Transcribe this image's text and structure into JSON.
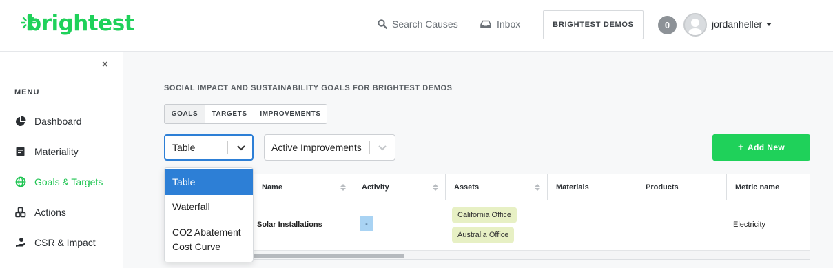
{
  "header": {
    "logo": "brightest",
    "search_label": "Search Causes",
    "inbox_label": "Inbox",
    "demos_label": "BRIGHTEST DEMOS",
    "notification_count": "0",
    "username": "jordanheller"
  },
  "sidebar": {
    "close_symbol": "×",
    "menu_heading": "MENU",
    "items": [
      {
        "label": "Dashboard",
        "icon": "pie-chart-icon"
      },
      {
        "label": "Materiality",
        "icon": "square-list-icon"
      },
      {
        "label": "Goals & Targets",
        "icon": "globe-icon",
        "active": true
      },
      {
        "label": "Actions",
        "icon": "cubes-icon"
      },
      {
        "label": "CSR & Impact",
        "icon": "hand-holding-icon"
      }
    ]
  },
  "main": {
    "title": "SOCIAL IMPACT AND SUSTAINABILITY GOALS FOR BRIGHTEST DEMOS",
    "tabs": [
      {
        "label": "GOALS",
        "active": true
      },
      {
        "label": "TARGETS"
      },
      {
        "label": "IMPROVEMENTS"
      }
    ],
    "view_select": {
      "value": "Table",
      "options": [
        "Table",
        "Waterfall",
        "CO2 Abatement",
        "Cost Curve"
      ]
    },
    "improvement_select": {
      "value": "Active Improvements"
    },
    "add_button": "Add New"
  },
  "table": {
    "columns": [
      "Name",
      "Activity",
      "Assets",
      "Materials",
      "Products",
      "Metric name"
    ],
    "rows": [
      {
        "name": "Solar Installations",
        "activity": "-",
        "assets": [
          "California Office",
          "Australia Office"
        ],
        "metric": "Electricity"
      }
    ]
  },
  "colors": {
    "brand_green": "#1fd15a",
    "select_blue": "#2d7fd6",
    "asset_chip": "#e7f0c4"
  }
}
